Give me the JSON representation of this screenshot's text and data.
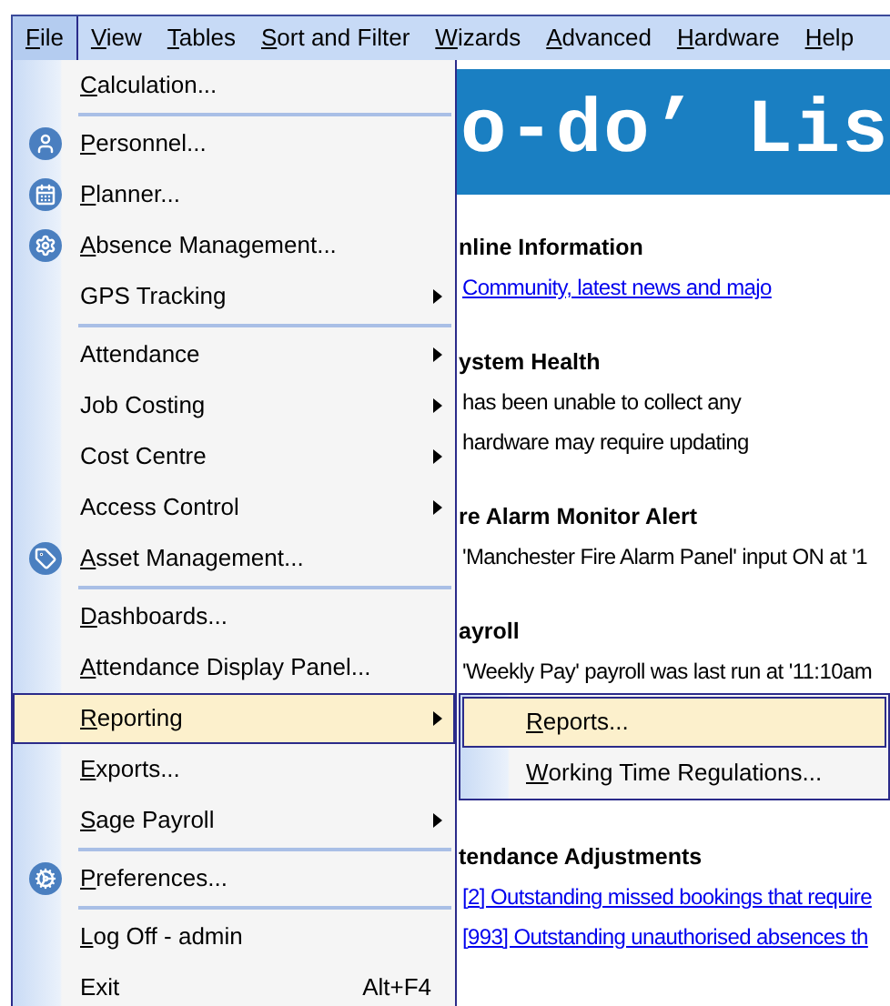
{
  "menubar": [
    {
      "label": "File",
      "mnemonic": true,
      "selected": true
    },
    {
      "label": "View",
      "mnemonic": true,
      "selected": false
    },
    {
      "label": "Tables",
      "mnemonic": true,
      "selected": false
    },
    {
      "label": "Sort and Filter",
      "mnemonic": true,
      "selected": false
    },
    {
      "label": "Wizards",
      "mnemonic": true,
      "selected": false
    },
    {
      "label": "Advanced",
      "mnemonic": true,
      "selected": false
    },
    {
      "label": "Hardware",
      "mnemonic": true,
      "selected": false
    },
    {
      "label": "Help",
      "mnemonic": true,
      "selected": false
    }
  ],
  "file_menu": [
    {
      "kind": "item",
      "label": "Calculation...",
      "mnemonic": true,
      "icon": false,
      "submenu": false,
      "selected": false
    },
    {
      "kind": "separator"
    },
    {
      "kind": "item",
      "label": "Personnel...",
      "mnemonic": true,
      "icon": true,
      "submenu": false,
      "selected": false
    },
    {
      "kind": "item",
      "label": "Planner...",
      "mnemonic": true,
      "icon": true,
      "submenu": false,
      "selected": false
    },
    {
      "kind": "item",
      "label": "Absence Management...",
      "mnemonic": true,
      "icon": true,
      "submenu": false,
      "selected": false
    },
    {
      "kind": "item",
      "label": "GPS Tracking",
      "mnemonic": false,
      "icon": false,
      "submenu": true,
      "selected": false
    },
    {
      "kind": "separator"
    },
    {
      "kind": "item",
      "label": "Attendance",
      "mnemonic": false,
      "icon": false,
      "submenu": true,
      "selected": false
    },
    {
      "kind": "item",
      "label": "Job Costing",
      "mnemonic": false,
      "icon": false,
      "submenu": true,
      "selected": false
    },
    {
      "kind": "item",
      "label": "Cost Centre",
      "mnemonic": false,
      "icon": false,
      "submenu": true,
      "selected": false
    },
    {
      "kind": "item",
      "label": "Access Control",
      "mnemonic": false,
      "icon": false,
      "submenu": true,
      "selected": false
    },
    {
      "kind": "item",
      "label": "Asset Management...",
      "mnemonic": true,
      "icon": true,
      "submenu": false,
      "selected": false
    },
    {
      "kind": "separator"
    },
    {
      "kind": "item",
      "label": "Dashboards...",
      "mnemonic": true,
      "icon": false,
      "submenu": false,
      "selected": false
    },
    {
      "kind": "item",
      "label": "Attendance Display Panel...",
      "mnemonic": true,
      "icon": false,
      "submenu": false,
      "selected": false
    },
    {
      "kind": "item",
      "label": "Reporting",
      "mnemonic": true,
      "icon": false,
      "submenu": true,
      "selected": true
    },
    {
      "kind": "item",
      "label": "Exports...",
      "mnemonic": true,
      "icon": false,
      "submenu": false,
      "selected": false
    },
    {
      "kind": "item",
      "label": "Sage Payroll",
      "mnemonic": true,
      "icon": false,
      "submenu": true,
      "selected": false
    },
    {
      "kind": "separator"
    },
    {
      "kind": "item",
      "label": "Preferences...",
      "mnemonic": true,
      "icon": true,
      "submenu": false,
      "selected": false
    },
    {
      "kind": "separator"
    },
    {
      "kind": "item",
      "label": "Log Off - admin",
      "mnemonic": true,
      "icon": false,
      "submenu": false,
      "selected": false
    },
    {
      "kind": "item",
      "label": "Exit",
      "mnemonic": false,
      "icon": false,
      "submenu": false,
      "selected": false,
      "shortcut": "Alt+F4"
    }
  ],
  "reporting_submenu": [
    {
      "label": "Reports...",
      "mnemonic": true,
      "selected": true
    },
    {
      "label": "Working Time Regulations...",
      "mnemonic": true,
      "selected": false
    }
  ],
  "banner": {
    "title": "o-do’ Lis"
  },
  "sections": [
    {
      "heading": "nline Information",
      "lines": [
        {
          "kind": "link",
          "text": "Community, latest news and majo"
        }
      ]
    },
    {
      "heading": "ystem Health",
      "lines": [
        {
          "kind": "text",
          "text": "has been unable to collect any"
        },
        {
          "kind": "text",
          "text": "hardware may require updating"
        }
      ]
    },
    {
      "heading": "re Alarm Monitor Alert",
      "lines": [
        {
          "kind": "text",
          "text": "'Manchester Fire Alarm Panel' input ON at '1"
        }
      ]
    },
    {
      "heading": "ayroll",
      "lines": [
        {
          "kind": "text",
          "text": "'Weekly Pay' payroll was last run at '11:10am"
        }
      ]
    },
    {
      "heading": "tendance Adjustments",
      "lines": [
        {
          "kind": "link",
          "text": "[2] Outstanding missed bookings that require"
        },
        {
          "kind": "link",
          "text": "[993] Outstanding unauthorised absences th"
        }
      ]
    }
  ]
}
